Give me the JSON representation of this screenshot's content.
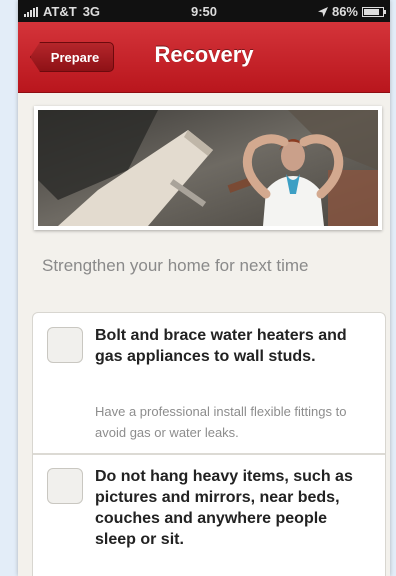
{
  "status": {
    "carrier": "AT&T",
    "network": "3G",
    "time": "9:50",
    "battery": "86%",
    "battery_level": 0.86
  },
  "nav": {
    "back_label": "Prepare",
    "title": "Recovery"
  },
  "section": {
    "title": "Strengthen your home for next time"
  },
  "checklist": [
    {
      "title": "Bolt and brace water heaters and gas appliances to wall studs.",
      "description": "Have a professional install flexible fittings to avoid gas or water leaks.",
      "checked": false
    },
    {
      "title": "Do not hang heavy items, such as pictures and mirrors, near beds, couches and anywhere people sleep or sit.",
      "checked": false
    }
  ],
  "colors": {
    "nav_red": "#c4242a",
    "background": "#f3f1ec",
    "muted_text": "#8a8a8a"
  }
}
